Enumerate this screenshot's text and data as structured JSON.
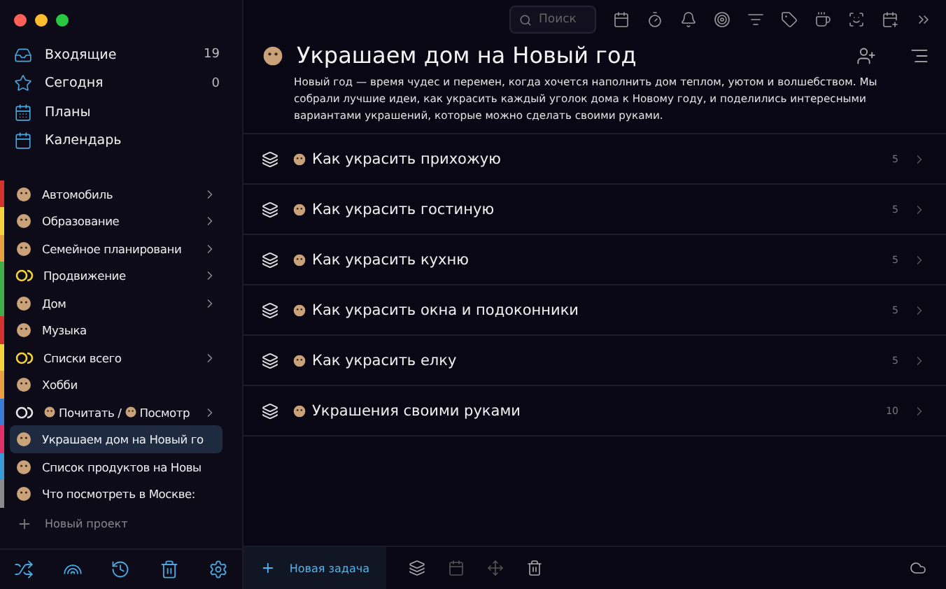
{
  "sidebar": {
    "pinned": [
      {
        "kind": "inbox",
        "label": "Входящие",
        "count": "19"
      },
      {
        "kind": "today",
        "label": "Сегодня",
        "count": "0"
      },
      {
        "kind": "plans",
        "label": "Планы"
      },
      {
        "kind": "calendar",
        "label": "Календарь"
      }
    ],
    "projects": [
      {
        "kind": "emoji",
        "label": "Автомобиль",
        "color": "#d0342c",
        "has_children": true,
        "selected": false
      },
      {
        "kind": "emoji",
        "label": "Образование",
        "color": "#f4d43a",
        "has_children": true,
        "selected": false
      },
      {
        "kind": "emoji",
        "label": "Семейное планировани",
        "color": "#e8a040",
        "has_children": true,
        "selected": false
      },
      {
        "kind": "rings",
        "label": "Продвижение",
        "color": "#3fae4a",
        "has_children": true,
        "selected": false
      },
      {
        "kind": "emoji",
        "label": "Дом",
        "color": "#3fae4a",
        "has_children": true,
        "selected": false
      },
      {
        "kind": "emoji",
        "label": "Музыка",
        "color": "#d0342c",
        "has_children": false,
        "selected": false
      },
      {
        "kind": "rings",
        "label": "Списки всего",
        "color": "#f4d43a",
        "has_children": true,
        "selected": false
      },
      {
        "kind": "emoji",
        "label": "Хобби",
        "color": "#e8a040",
        "has_children": false,
        "selected": false
      },
      {
        "kind": "rings",
        "label_parts": [
          "Почитать /",
          "Посмотр"
        ],
        "color": "#3a7bd5",
        "has_children": true,
        "selected": false
      },
      {
        "kind": "emoji",
        "label": "Украшаем дом на Новый го",
        "color": "#e0306a",
        "has_children": false,
        "selected": true
      },
      {
        "kind": "emoji",
        "label": "Список продуктов на Новы",
        "color": "#3a9ad5",
        "has_children": false,
        "selected": false
      },
      {
        "kind": "emoji",
        "label": "Что посмотреть в Москве:",
        "color": "#8a8a8a",
        "has_children": false,
        "selected": false
      }
    ],
    "new_project": "Новый проект"
  },
  "toolbar": {
    "search": {
      "placeholder": "Поиск"
    }
  },
  "project": {
    "title": "Украшаем дом на Новый год",
    "description": "Новый год — время чудес и перемен, когда хочется наполнить дом теплом, уютом и волшебством. Мы собрали лучшие идеи, как украсить каждый уголок дома к Новому году, и поделились интересными вариантами украшений, которые можно сделать своими руками.",
    "sections": [
      {
        "title": "Как украсить прихожую",
        "count": "5"
      },
      {
        "title": "Как украсить гостиную",
        "count": "5"
      },
      {
        "title": "Как украсить кухню",
        "count": "5"
      },
      {
        "title": "Как украсить окна и подоконники",
        "count": "5"
      },
      {
        "title": "Как украсить елку",
        "count": "5"
      },
      {
        "title": "Украшения своими руками",
        "count": "10"
      }
    ]
  },
  "bottom_bar": {
    "new_task": "Новая задача"
  }
}
